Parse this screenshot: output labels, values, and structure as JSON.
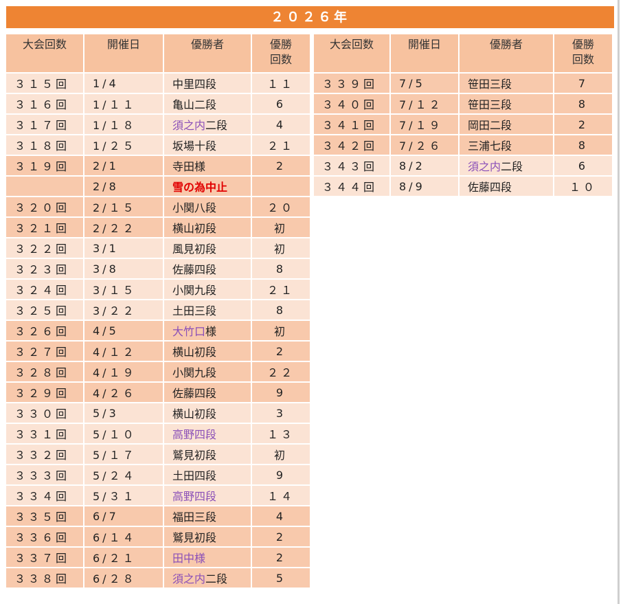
{
  "title": "２０２６年",
  "headers": {
    "round": "大会回数",
    "date": "開催日",
    "winner": "優勝者",
    "count_line1": "優勝",
    "count_line2": "回数"
  },
  "colors": {
    "title_bar": "#ee8433",
    "header_bg": "#f7c29f",
    "row_light": "#fbe3d4",
    "row_dark": "#f8c9ac",
    "purple_text": "#8a4fb8",
    "red_text": "#e10000"
  },
  "left_rows": [
    {
      "round": "３１５回",
      "date": "1/4",
      "winner": "中里四段",
      "count": "１１",
      "tone": "odd"
    },
    {
      "round": "３１６回",
      "date": "1/１１",
      "winner": "亀山二段",
      "count": "6",
      "tone": "odd"
    },
    {
      "round": "３１７回",
      "date": "1/１８",
      "winner_purple": "須之内",
      "winner": "二段",
      "count": "4",
      "tone": "odd"
    },
    {
      "round": "３１８回",
      "date": "1/２５",
      "winner": "坂場十段",
      "count": "２１",
      "tone": "odd"
    },
    {
      "round": "３１９回",
      "date": "2/1",
      "winner": "寺田様",
      "count": "2",
      "tone": "even"
    },
    {
      "round": "",
      "date": "2/8",
      "winner_red": "雪の為中止",
      "count": "",
      "tone": "even"
    },
    {
      "round": "３２０回",
      "date": "2/１５",
      "winner": "小関八段",
      "count": "２０",
      "tone": "even"
    },
    {
      "round": "３２１回",
      "date": "2/２２",
      "winner": "横山初段",
      "count": "初",
      "tone": "even"
    },
    {
      "round": "３２２回",
      "date": "3/1",
      "winner": "風見初段",
      "count": "初",
      "tone": "odd"
    },
    {
      "round": "３２３回",
      "date": "3/8",
      "winner": "佐藤四段",
      "count": "8",
      "tone": "odd"
    },
    {
      "round": "３２４回",
      "date": "3/１５",
      "winner": "小関九段",
      "count": "２１",
      "tone": "odd"
    },
    {
      "round": "３２５回",
      "date": "3/２２",
      "winner": "土田三段",
      "count": "8",
      "tone": "odd"
    },
    {
      "round": "３２６回",
      "date": "4/5",
      "winner_purple": "大竹口",
      "winner": "様",
      "count": "初",
      "tone": "even"
    },
    {
      "round": "３２７回",
      "date": "4/１２",
      "winner": "横山初段",
      "count": "2",
      "tone": "even"
    },
    {
      "round": "３２８回",
      "date": "4/１９",
      "winner": "小関九段",
      "count": "２２",
      "tone": "even"
    },
    {
      "round": "３２９回",
      "date": "4/２６",
      "winner": "佐藤四段",
      "count": "9",
      "tone": "even"
    },
    {
      "round": "３３０回",
      "date": "5/3",
      "winner": "横山初段",
      "count": "3",
      "tone": "odd"
    },
    {
      "round": "３３１回",
      "date": "5/１０",
      "winner_purple": "高野四段",
      "count": "１３",
      "tone": "odd"
    },
    {
      "round": "３３２回",
      "date": "5/１７",
      "winner": "鷲見初段",
      "count": "初",
      "tone": "odd"
    },
    {
      "round": "３３３回",
      "date": "5/２４",
      "winner": "土田四段",
      "count": "9",
      "tone": "odd"
    },
    {
      "round": "３３４回",
      "date": "5/３１",
      "winner_purple": "高野四段",
      "count": "１４",
      "tone": "odd"
    },
    {
      "round": "３３５回",
      "date": "6/7",
      "winner": "福田三段",
      "count": "4",
      "tone": "even"
    },
    {
      "round": "３３６回",
      "date": "6/１４",
      "winner": "鷲見初段",
      "count": "2",
      "tone": "even"
    },
    {
      "round": "３３７回",
      "date": "6/２１",
      "winner_purple": "田中様",
      "count": "2",
      "tone": "even"
    },
    {
      "round": "３３８回",
      "date": "6/２８",
      "winner_purple": "須之内",
      "winner": "二段",
      "count": "5",
      "tone": "even"
    }
  ],
  "right_rows": [
    {
      "round": "３３９回",
      "date": "7/5",
      "winner": "笹田三段",
      "count": "7",
      "tone": "even"
    },
    {
      "round": "３４０回",
      "date": "7/１２",
      "winner": "笹田三段",
      "count": "8",
      "tone": "even"
    },
    {
      "round": "３４１回",
      "date": "7/１９",
      "winner": "岡田二段",
      "count": "2",
      "tone": "even"
    },
    {
      "round": "３４２回",
      "date": "7/２６",
      "winner": "三浦七段",
      "count": "8",
      "tone": "even"
    },
    {
      "round": "３４３回",
      "date": "8/2",
      "winner_purple": "須之内",
      "winner": "二段",
      "count": "6",
      "tone": "odd"
    },
    {
      "round": "３４４回",
      "date": "8/9",
      "winner": "佐藤四段",
      "count": "１０",
      "tone": "odd"
    }
  ]
}
